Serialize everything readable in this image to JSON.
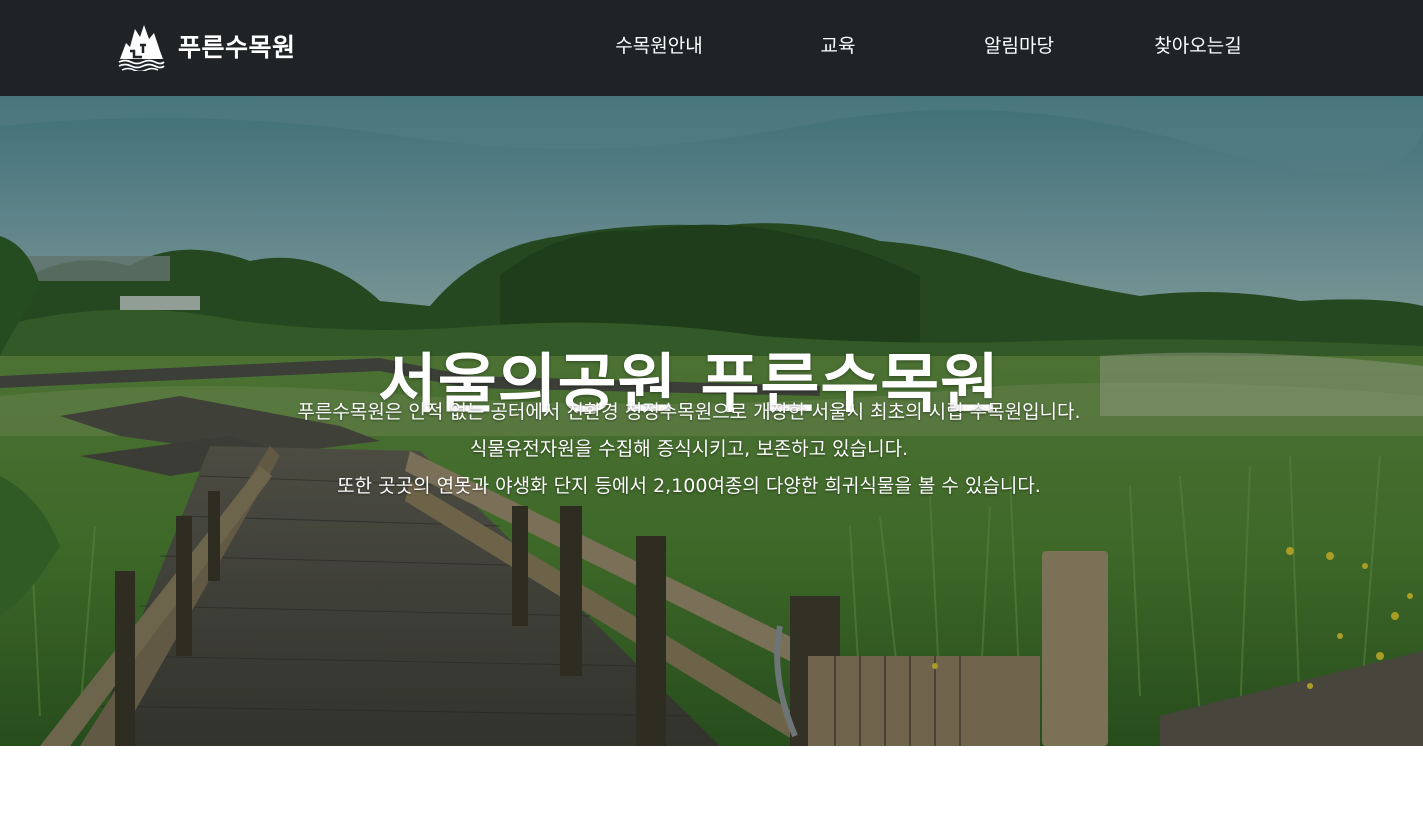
{
  "header": {
    "logo_text": "푸른수목원",
    "logo_icon": "mountain-forest-logo-icon",
    "background_color": "#1f2326",
    "nav": [
      {
        "label": "수목원안내"
      },
      {
        "label": "교육"
      },
      {
        "label": "알림마당"
      },
      {
        "label": "찾아오는길"
      }
    ]
  },
  "hero": {
    "title": "서울의공원 푸른수목원",
    "description": [
      "푸른수목원은 인적 없는 공터에서 친환경 청정수목원으로 개장한 서울시 최초의 시립 수목원입니다.",
      "식물유전자원을 수집해 증식시키고, 보존하고 있습니다.",
      "또한 곳곳의 연못과 야생화 단지 등에서 2,100여종의 다양한 희귀식물을 볼 수 있습니다."
    ],
    "image": "wooden-boardwalk-through-wetland-grass-image"
  }
}
